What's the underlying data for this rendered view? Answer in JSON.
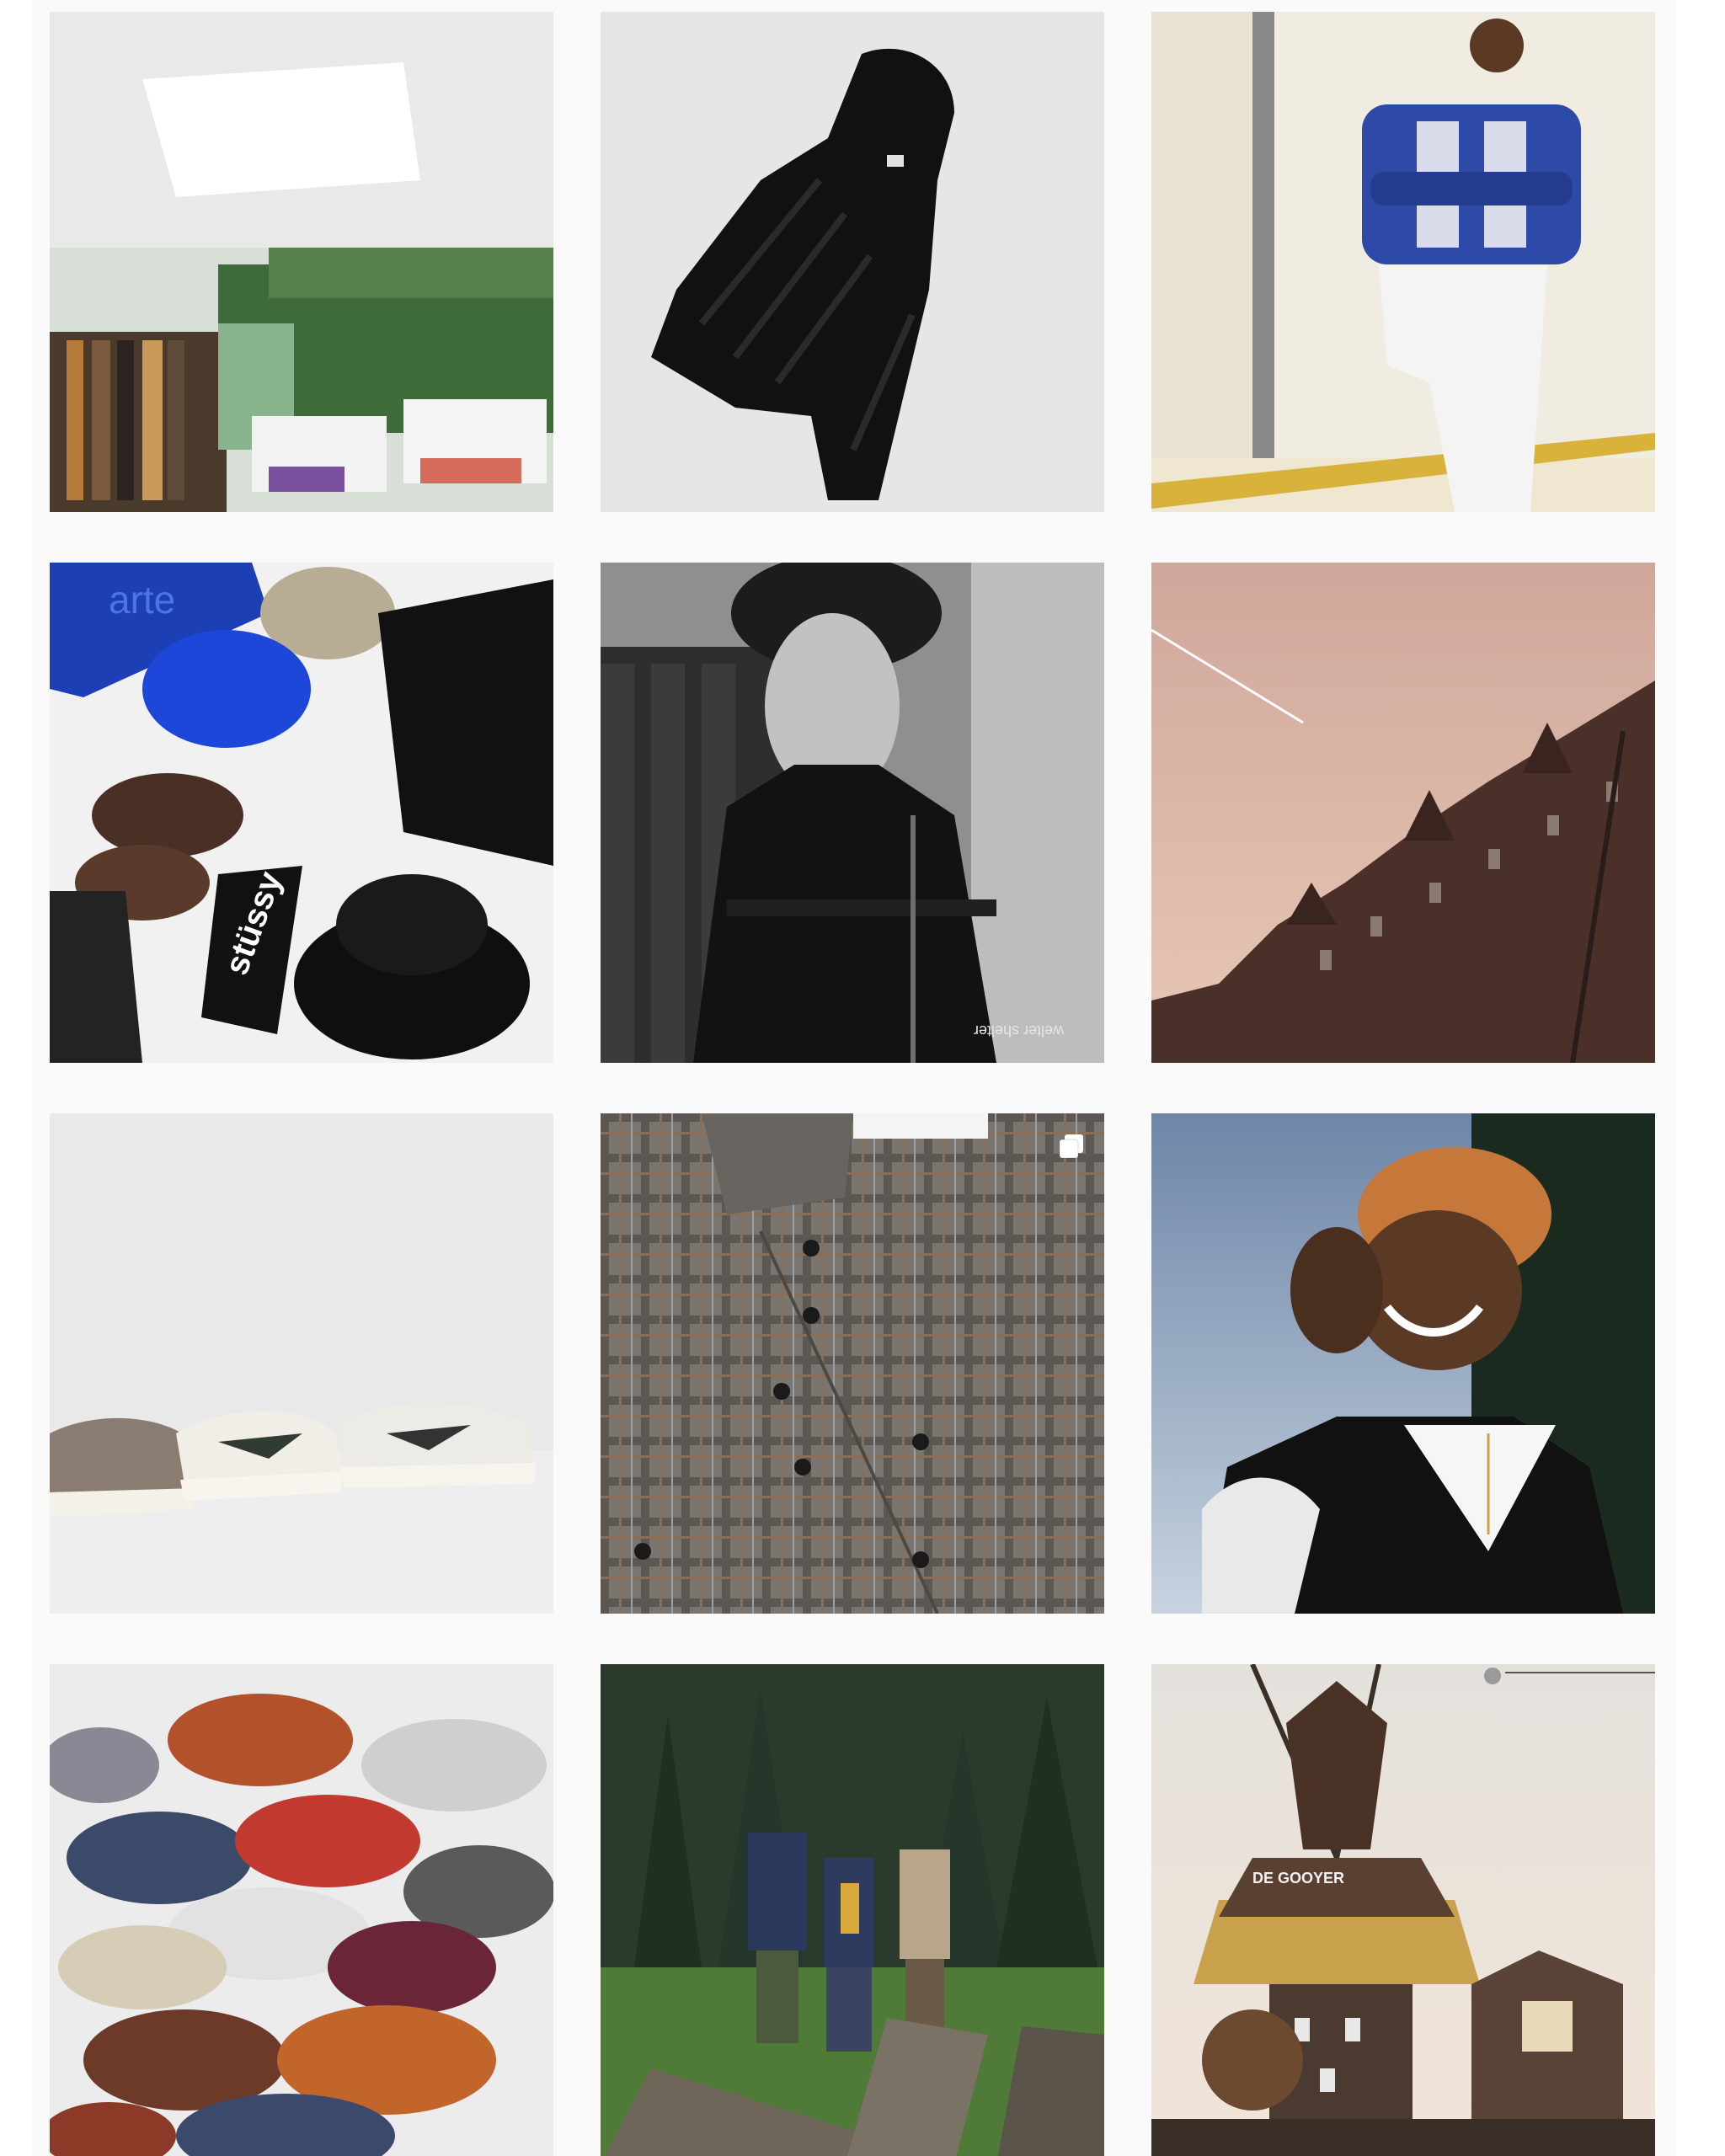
{
  "feed": {
    "posts": [
      {
        "id": 1,
        "subject": "store interior",
        "multiple": false
      },
      {
        "id": 2,
        "subject": "black puffer jacket",
        "multiple": false
      },
      {
        "id": 3,
        "subject": "model in blue cardigan",
        "multiple": false
      },
      {
        "id": 4,
        "subject": "flat lay accessories",
        "multiple": false,
        "text": {
          "scarf": "arte",
          "sock": "stüssy"
        }
      },
      {
        "id": 5,
        "subject": "model in black beanie",
        "multiple": false,
        "text": {
          "jacket": "welter shelter"
        }
      },
      {
        "id": 6,
        "subject": "canal houses at dusk",
        "multiple": false
      },
      {
        "id": 7,
        "subject": "sneakers row",
        "multiple": false
      },
      {
        "id": 8,
        "subject": "plaid overshirt",
        "multiple": true
      },
      {
        "id": 9,
        "subject": "model in orange beanie",
        "multiple": false
      },
      {
        "id": 10,
        "subject": "sneaker pile",
        "multiple": false
      },
      {
        "id": 11,
        "subject": "forest walk",
        "multiple": false
      },
      {
        "id": 12,
        "subject": "windmill",
        "multiple": false,
        "text": {
          "sign": "DE GOOYER"
        }
      }
    ]
  },
  "colors": {
    "background": "#fafafa",
    "page": "#ffffff"
  },
  "icons": {
    "multi_post": "multiple-photos-icon"
  }
}
